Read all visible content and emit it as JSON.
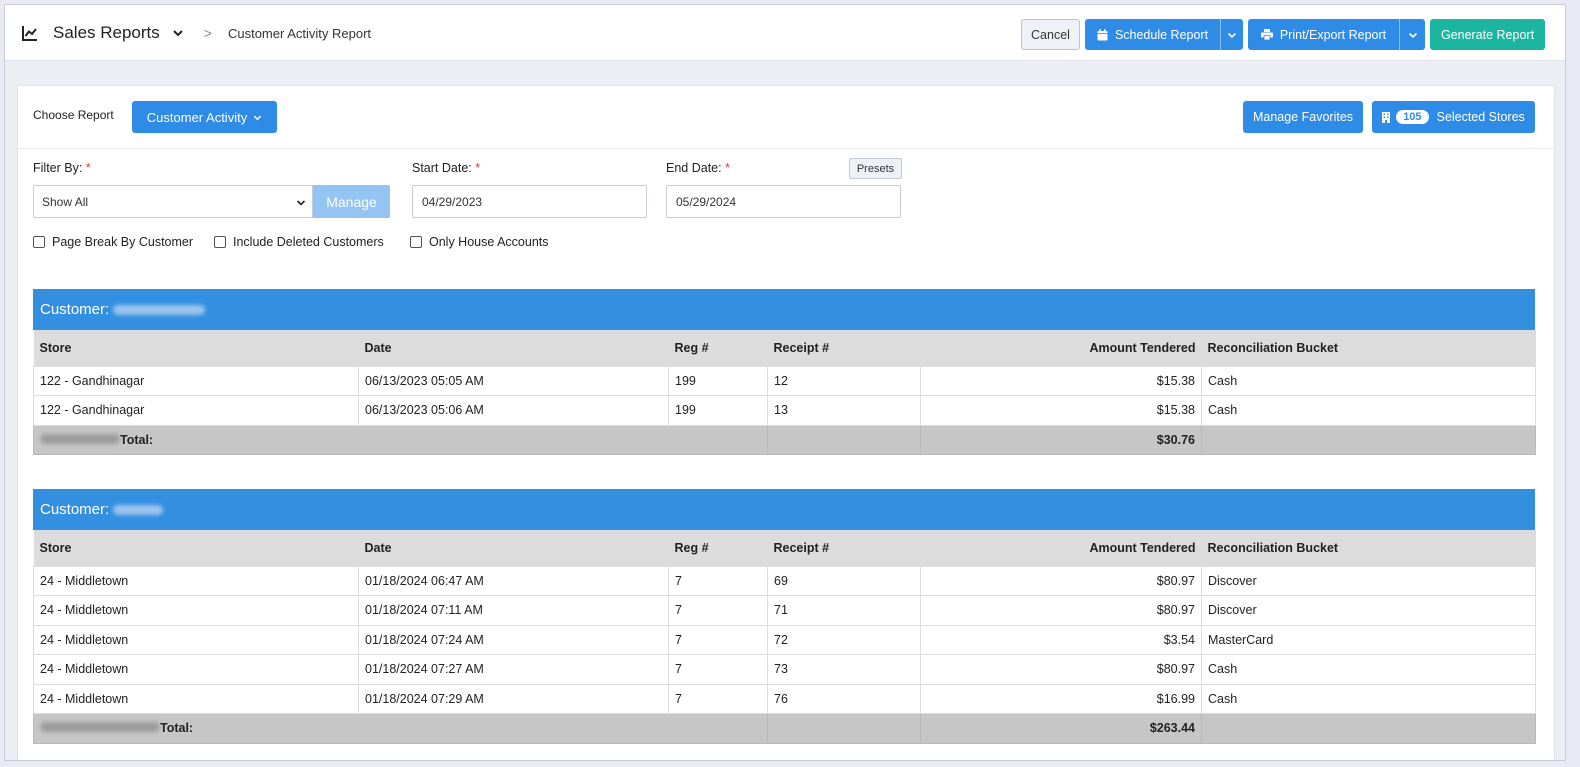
{
  "header": {
    "title": "Sales Reports",
    "separator": ">",
    "subtitle": "Customer Activity Report",
    "buttons": {
      "cancel": "Cancel",
      "schedule": "Schedule Report",
      "print_export": "Print/Export Report",
      "generate": "Generate Report"
    }
  },
  "toolbar": {
    "choose_label": "Choose Report",
    "choose_value": "Customer Activity",
    "manage_favorites": "Manage Favorites",
    "stores_count": "105",
    "stores_label": "Selected Stores"
  },
  "filters": {
    "filter_by_label": "Filter By:",
    "filter_by_value": "Show All",
    "manage_label": "Manage",
    "start_date_label": "Start Date:",
    "start_date_value": "04/29/2023",
    "end_date_label": "End Date:",
    "end_date_value": "05/29/2024",
    "required_mark": "*",
    "presets_label": "Presets",
    "checkboxes": [
      {
        "label": "Page Break By Customer",
        "checked": false
      },
      {
        "label": "Include Deleted Customers",
        "checked": false
      },
      {
        "label": "Only House Accounts",
        "checked": false
      }
    ]
  },
  "report": {
    "customer_prefix": "Customer:",
    "total_label": "Total:",
    "columns": [
      "Store",
      "Date",
      "Reg #",
      "Receipt #",
      "Amount Tendered",
      "Reconciliation Bucket"
    ],
    "groups": [
      {
        "rows": [
          [
            "122 - Gandhinagar",
            "06/13/2023 05:05 AM",
            "199",
            "12",
            "$15.38",
            "Cash"
          ],
          [
            "122 - Gandhinagar",
            "06/13/2023 05:06 AM",
            "199",
            "13",
            "$15.38",
            "Cash"
          ]
        ],
        "total": "$30.76"
      },
      {
        "rows": [
          [
            "24 - Middletown",
            "01/18/2024 06:47 AM",
            "7",
            "69",
            "$80.97",
            "Discover"
          ],
          [
            "24 - Middletown",
            "01/18/2024 07:11 AM",
            "7",
            "71",
            "$80.97",
            "Discover"
          ],
          [
            "24 - Middletown",
            "01/18/2024 07:24 AM",
            "7",
            "72",
            "$3.54",
            "MasterCard"
          ],
          [
            "24 - Middletown",
            "01/18/2024 07:27 AM",
            "7",
            "73",
            "$80.97",
            "Cash"
          ],
          [
            "24 - Middletown",
            "01/18/2024 07:29 AM",
            "7",
            "76",
            "$16.99",
            "Cash"
          ]
        ],
        "total": "$263.44"
      }
    ]
  },
  "colors": {
    "primary": "#2e8be6",
    "success": "#1bb5a0",
    "customer_bar": "#3390e0"
  }
}
